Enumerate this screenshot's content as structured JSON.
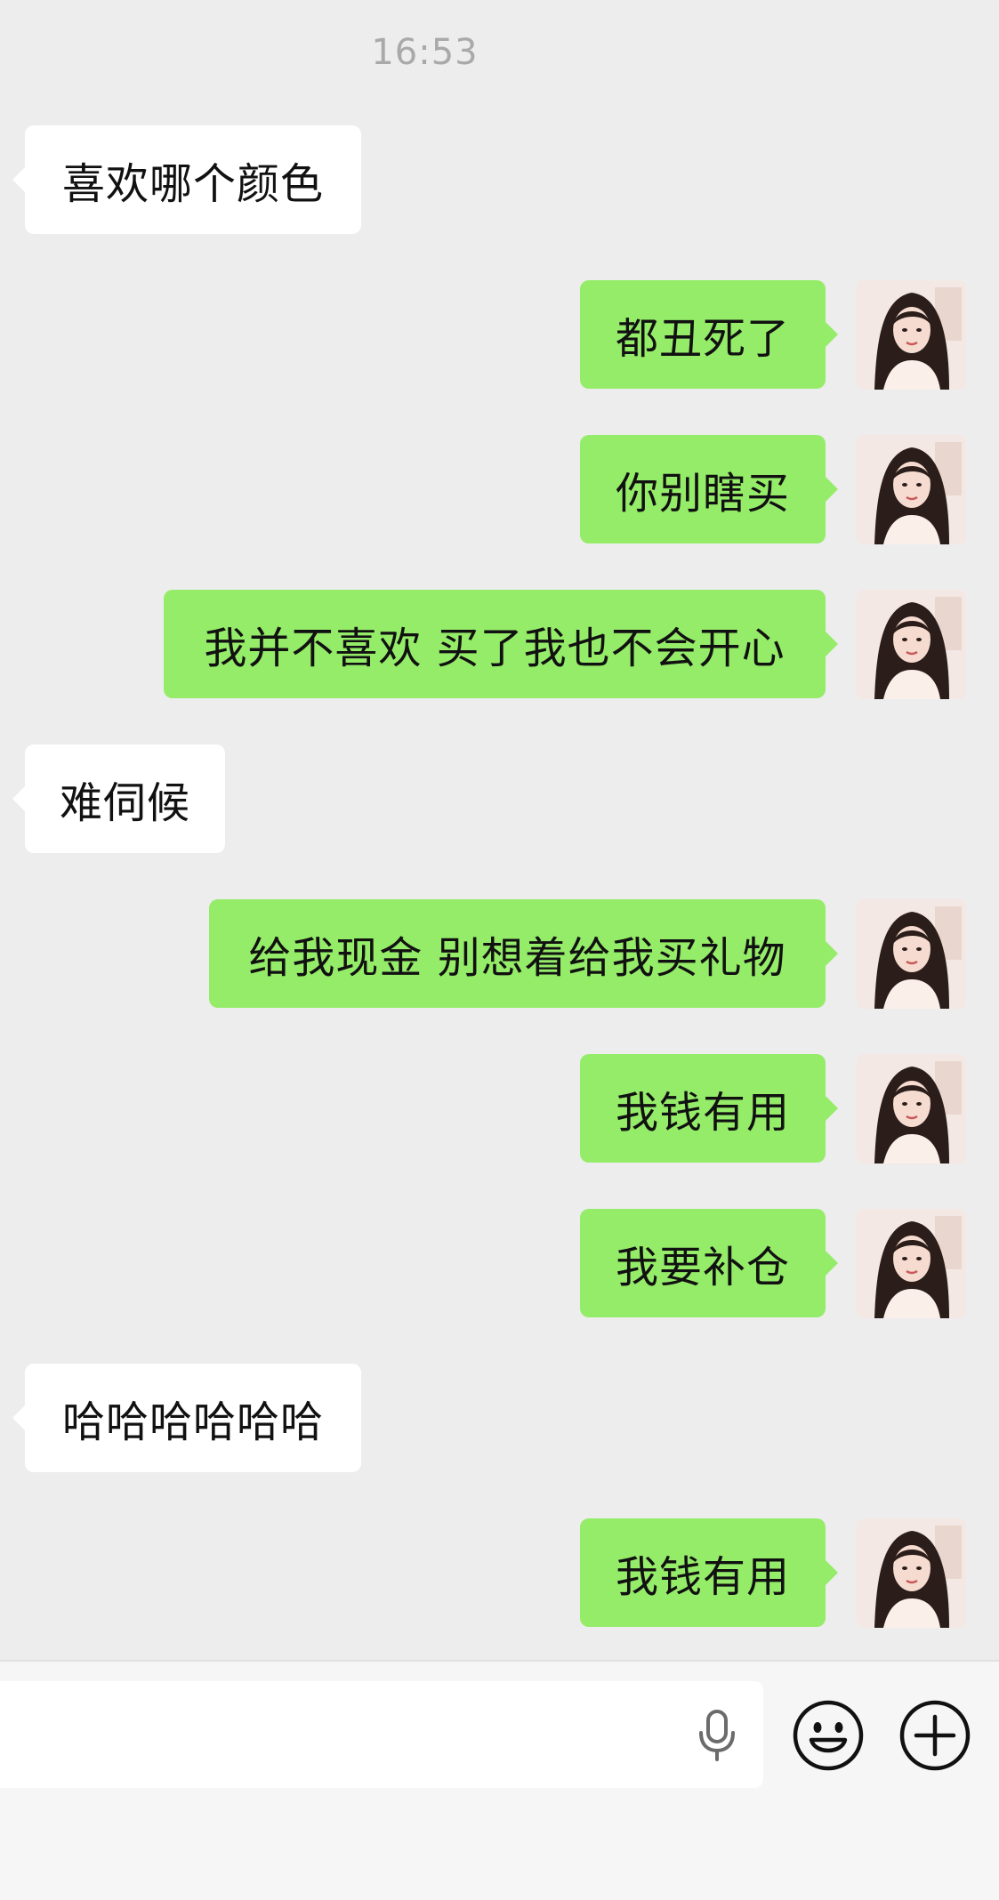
{
  "chat": {
    "timestamp": "16:53",
    "messages": [
      {
        "side": "received",
        "text": "喜欢哪个颜色"
      },
      {
        "side": "sent",
        "text": "都丑死了"
      },
      {
        "side": "sent",
        "text": "你别瞎买"
      },
      {
        "side": "sent",
        "text": "我并不喜欢 买了我也不会开心"
      },
      {
        "side": "received",
        "text": "难伺候"
      },
      {
        "side": "sent",
        "text": "给我现金 别想着给我买礼物"
      },
      {
        "side": "sent",
        "text": "我钱有用"
      },
      {
        "side": "sent",
        "text": "我要补仓"
      },
      {
        "side": "received",
        "text": "哈哈哈哈哈哈"
      },
      {
        "side": "sent",
        "text": "我钱有用"
      }
    ]
  },
  "input_bar": {
    "text_value": "",
    "icons": [
      "microphone-icon",
      "emoji-icon",
      "plus-icon"
    ]
  },
  "colors": {
    "chat_background": "#ededed",
    "sent_bubble": "#95ec69",
    "received_bubble": "#ffffff",
    "input_bar_background": "#f6f6f6"
  }
}
